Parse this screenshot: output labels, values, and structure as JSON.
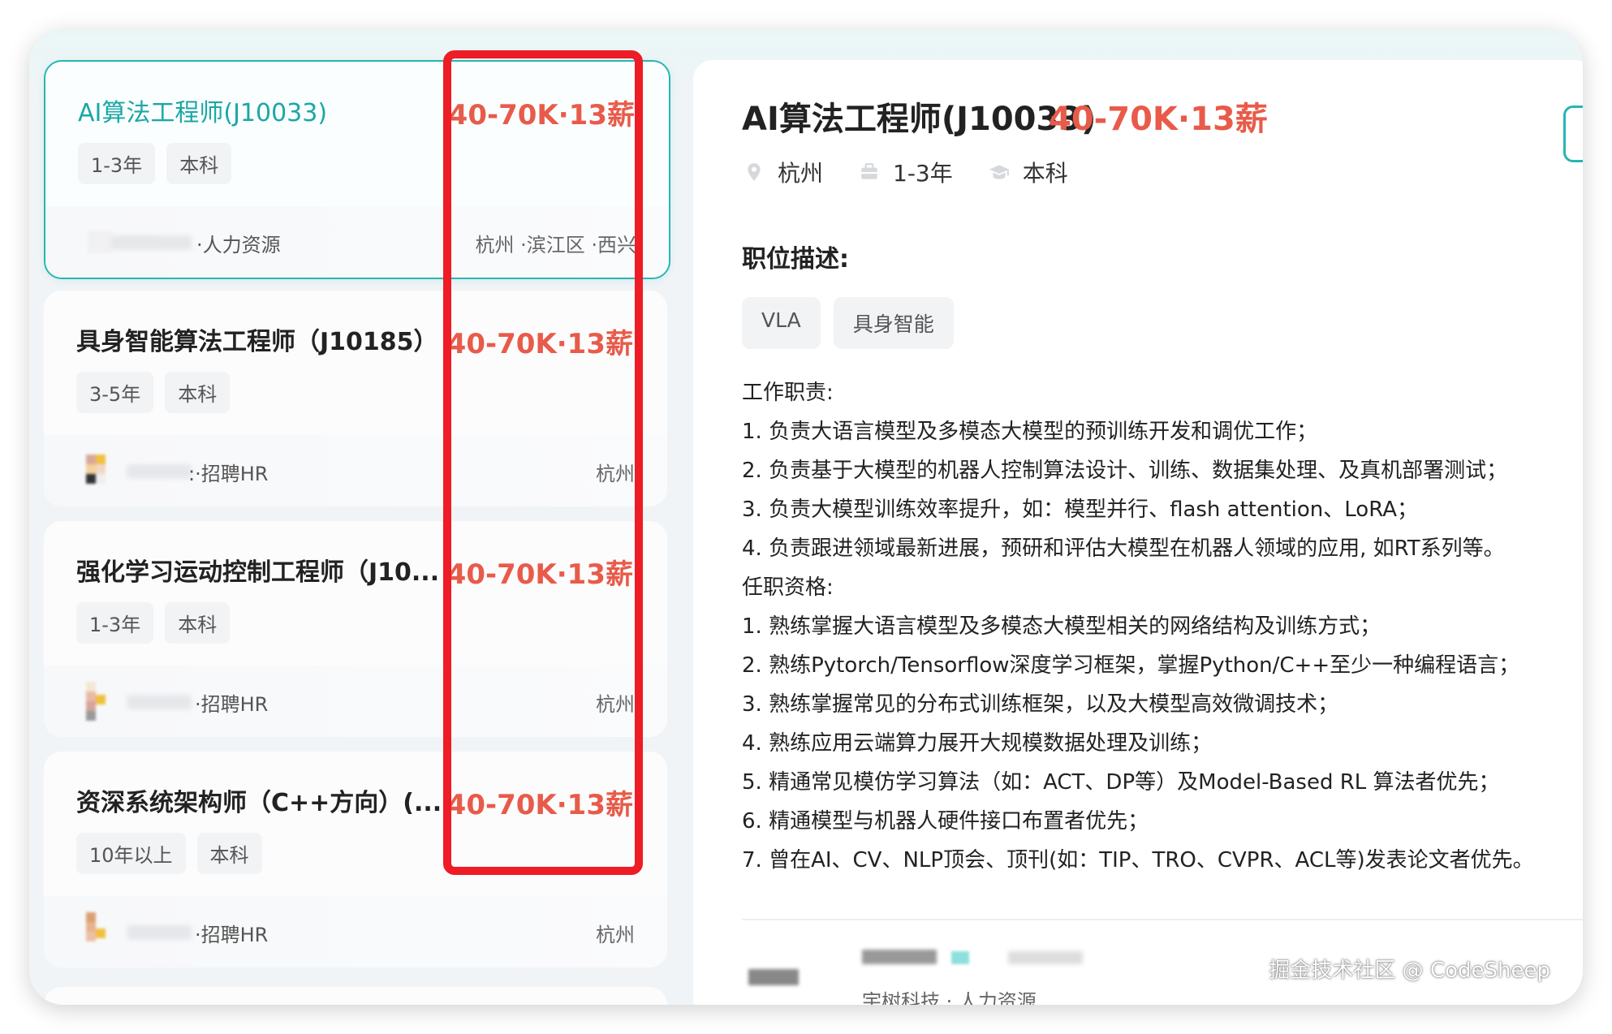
{
  "jobs": [
    {
      "title": "AI算法工程师(J10033)",
      "salary": "40-70K·13薪",
      "tags": [
        "1-3年",
        "本科"
      ],
      "recruiter": "·人力资源",
      "location": "杭州 ·滨江区 ·西兴"
    },
    {
      "title": "具身智能算法工程师（J10185）",
      "salary": "40-70K·13薪",
      "tags": [
        "3-5年",
        "本科"
      ],
      "recruiter": ":·招聘HR",
      "location": "杭州"
    },
    {
      "title": "强化学习运动控制工程师（J10...",
      "salary": "40-70K·13薪",
      "tags": [
        "1-3年",
        "本科"
      ],
      "recruiter": "·招聘HR",
      "location": "杭州"
    },
    {
      "title": "资深系统架构师（C++方向）(...",
      "salary": "40-70K·13薪",
      "tags": [
        "10年以上",
        "本科"
      ],
      "recruiter": "·招聘HR",
      "location": "杭州"
    }
  ],
  "detail": {
    "title": "AI算法工程师(J10033)",
    "salary": "40-70K·13薪",
    "meta": {
      "city": "杭州",
      "experience": "1-3年",
      "education": "本科"
    },
    "section_heading": "职位描述:",
    "tags": [
      "VLA",
      "具身智能"
    ],
    "lines": [
      "工作职责:",
      "1. 负责大语言模型及多模态大模型的预训练开发和调优工作；",
      "2. 负责基于大模型的机器人控制算法设计、训练、数据集处理、及真机部署测试；",
      "3. 负责大模型训练效率提升，如：模型并行、flash attention、LoRA；",
      "4. 负责跟进领域最新进展，预研和评估大模型在机器人领域的应用, 如RT系列等。",
      "任职资格:",
      "1. 熟练掌握大语言模型及多模态大模型相关的网络结构及训练方式；",
      "2. 熟练Pytorch/Tensorflow深度学习框架，掌握Python/C++至少一种编程语言；",
      "3. 熟练掌握常见的分布式训练框架，以及大模型高效微调技术；",
      "4. 熟练应用云端算力展开大规模数据处理及训练；",
      "5. 精通常见模仿学习算法（如：ACT、DP等）及Model-Based RL 算法者优先；",
      "6. 精通模型与机器人硬件接口布置者优先；",
      "7. 曾在AI、CV、NLP顶会、顶刊(如：TIP、TRO、CVPR、ACL等)发表论文者优先。"
    ],
    "company": "宇树科技 · 人力资源"
  },
  "watermark": "掘金技术社区 @ CodeSheep",
  "colors": {
    "accent": "#27b5b5",
    "salary": "#e85b4a",
    "highlight_box": "#ee1c25"
  },
  "icons": {
    "city": "location-pin-icon",
    "experience": "briefcase-icon",
    "education": "graduation-cap-icon"
  }
}
